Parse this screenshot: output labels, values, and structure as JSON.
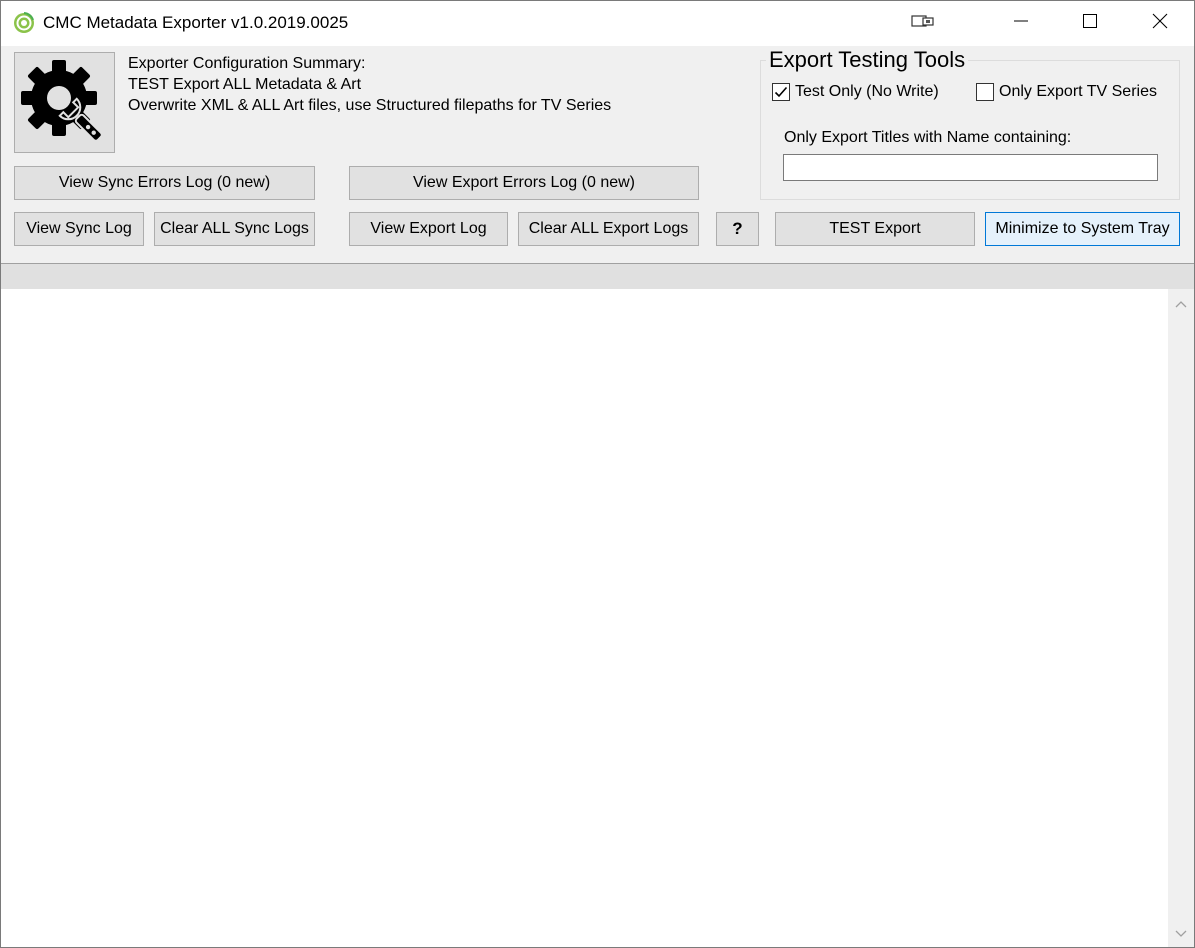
{
  "window": {
    "title": "CMC Metadata Exporter v1.0.2019.0025",
    "icon": "app-swirl-icon",
    "controls": [
      "restore-tray-icon",
      "minimize-icon",
      "maximize-icon",
      "close-icon"
    ]
  },
  "config_summary": {
    "heading": "Exporter Configuration Summary:",
    "line1": "TEST Export ALL Metadata & Art",
    "line2": "Overwrite XML & ALL Art files, use Structured filepaths for TV Series",
    "icon": "gear-wrench-icon"
  },
  "buttons": {
    "view_sync_errors": "View Sync Errors Log (0 new)",
    "view_export_errors": "View Export Errors Log (0 new)",
    "view_sync_log": "View Sync Log",
    "clear_sync_logs": "Clear ALL Sync Logs",
    "view_export_log": "View Export Log",
    "clear_export_logs": "Clear ALL Export Logs",
    "help": "?",
    "test_export": "TEST Export",
    "minimize_tray": "Minimize to System Tray"
  },
  "testing_tools": {
    "title": "Export Testing Tools",
    "test_only": {
      "label": "Test Only (No Write)",
      "checked": true
    },
    "only_tv": {
      "label": "Only Export TV Series",
      "checked": false
    },
    "name_filter_label": "Only Export Titles with Name containing:",
    "name_filter_value": ""
  },
  "log": {
    "content": ""
  },
  "colors": {
    "accent": "#0078d7",
    "button_face": "#e1e1e1",
    "window_bg": "#f0f0f0"
  }
}
